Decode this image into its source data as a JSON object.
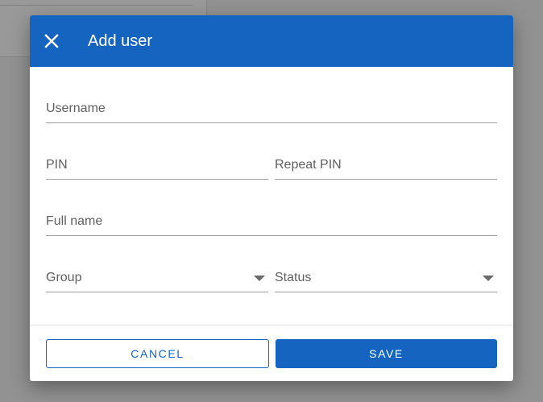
{
  "colors": {
    "primary": "#1565c0",
    "header_text": "#ffffff",
    "label_text": "#5f5f5f",
    "underline": "#9e9e9e"
  },
  "dialog": {
    "title": "Add user",
    "close_icon": "close-icon"
  },
  "form": {
    "username": {
      "label": "Username",
      "value": ""
    },
    "pin": {
      "label": "PIN",
      "value": ""
    },
    "repeat_pin": {
      "label": "Repeat PIN",
      "value": ""
    },
    "full_name": {
      "label": "Full name",
      "value": ""
    },
    "group": {
      "label": "Group",
      "selected": "",
      "icon": "dropdown-arrow-icon"
    },
    "status": {
      "label": "Status",
      "selected": "",
      "icon": "dropdown-arrow-icon"
    }
  },
  "actions": {
    "cancel_label": "CANCEL",
    "save_label": "SAVE"
  }
}
